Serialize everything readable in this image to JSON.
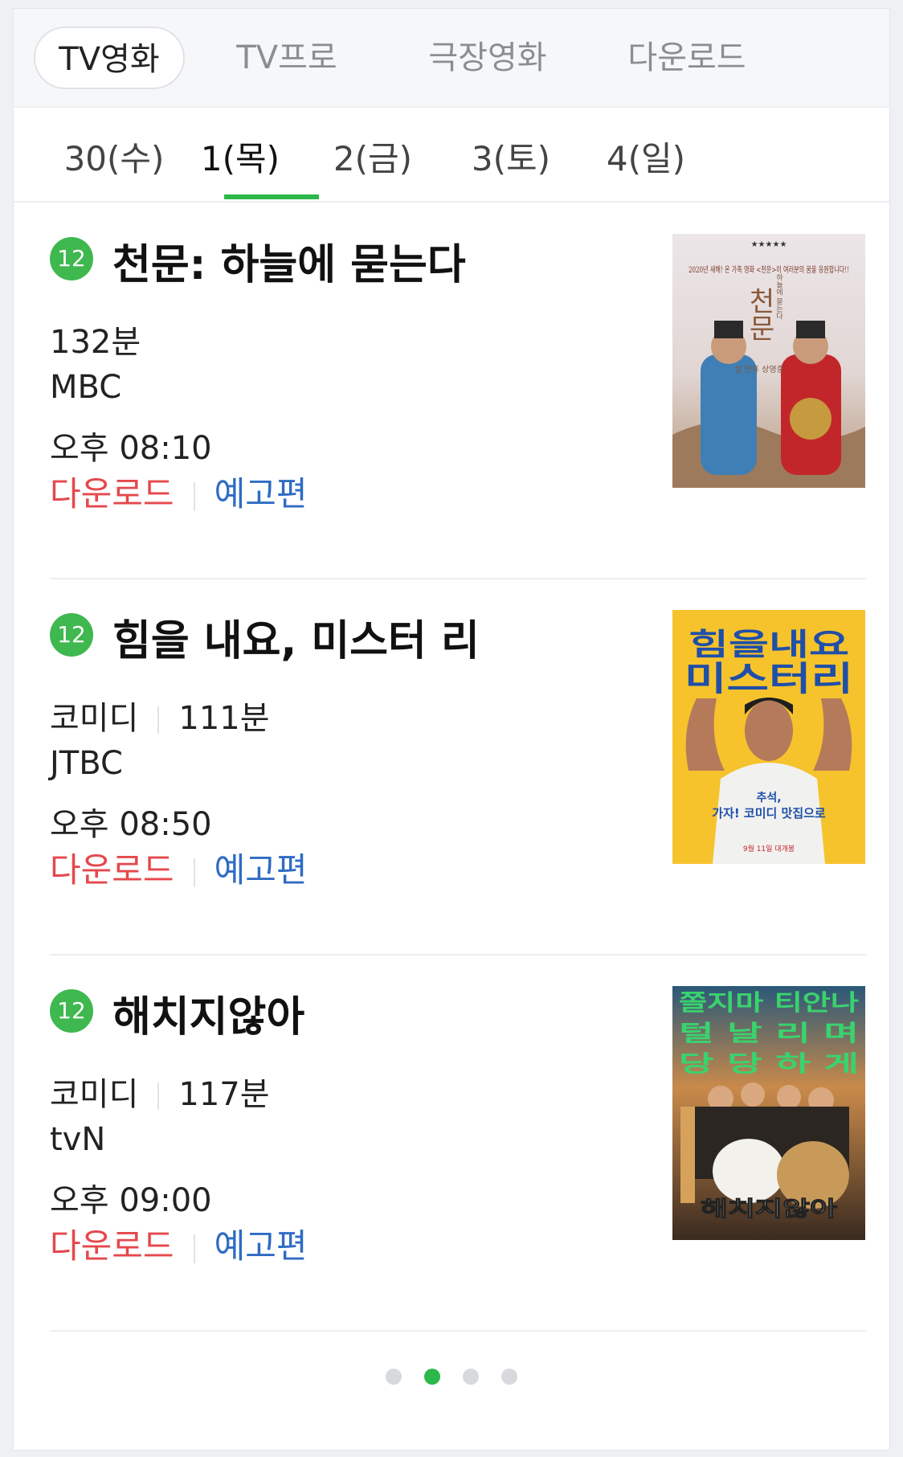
{
  "top_tabs": [
    {
      "label": "TV영화",
      "active": true
    },
    {
      "label": "TV프로",
      "active": false
    },
    {
      "label": "극장영화",
      "active": false
    },
    {
      "label": "다운로드",
      "active": false
    }
  ],
  "day_tabs": [
    {
      "label": "30(수)",
      "active": false
    },
    {
      "label": "1(목)",
      "active": true
    },
    {
      "label": "2(금)",
      "active": false
    },
    {
      "label": "3(토)",
      "active": false
    },
    {
      "label": "4(일)",
      "active": false
    }
  ],
  "colors": {
    "accent_green": "#2db84b",
    "download_red": "#e5484d",
    "trailer_blue": "#2f6cc4"
  },
  "movies": [
    {
      "rating": "12",
      "title": "천문: 하늘에 묻는다",
      "genre": "",
      "runtime": "132분",
      "channel": "MBC",
      "time": "오후 08:10",
      "download_label": "다운로드",
      "trailer_label": "예고편",
      "poster": {
        "stars": "★★★★★",
        "tagline": "2020년 새해! 온 가족 영화 <천문>이 여러분의 꿈을 응원합니다!!",
        "title": "천문",
        "subtitle": "하늘에 묻는다",
        "note": "설 연휴 상영중"
      }
    },
    {
      "rating": "12",
      "title": "힘을 내요, 미스터 리",
      "genre": "코미디",
      "runtime": "111분",
      "channel": "JTBC",
      "time": "오후 08:50",
      "download_label": "다운로드",
      "trailer_label": "예고편",
      "poster": {
        "title_line1": "힘을내요",
        "title_line2": "미스터리",
        "tagline_line1": "추석,",
        "tagline_line2": "가자! 코미디 맛집으로",
        "note": "9월 11일 대개봉"
      }
    },
    {
      "rating": "12",
      "title": "해치지않아",
      "genre": "코미디",
      "runtime": "117분",
      "channel": "tvN",
      "time": "오후 09:00",
      "download_label": "다운로드",
      "trailer_label": "예고편",
      "poster": {
        "line1": "쫄지마 티안나",
        "line2": "털 날 리 며",
        "line3": "당 당 하 게",
        "title": "해치지않아"
      }
    }
  ],
  "pagination": {
    "total": 4,
    "active_index": 1
  }
}
